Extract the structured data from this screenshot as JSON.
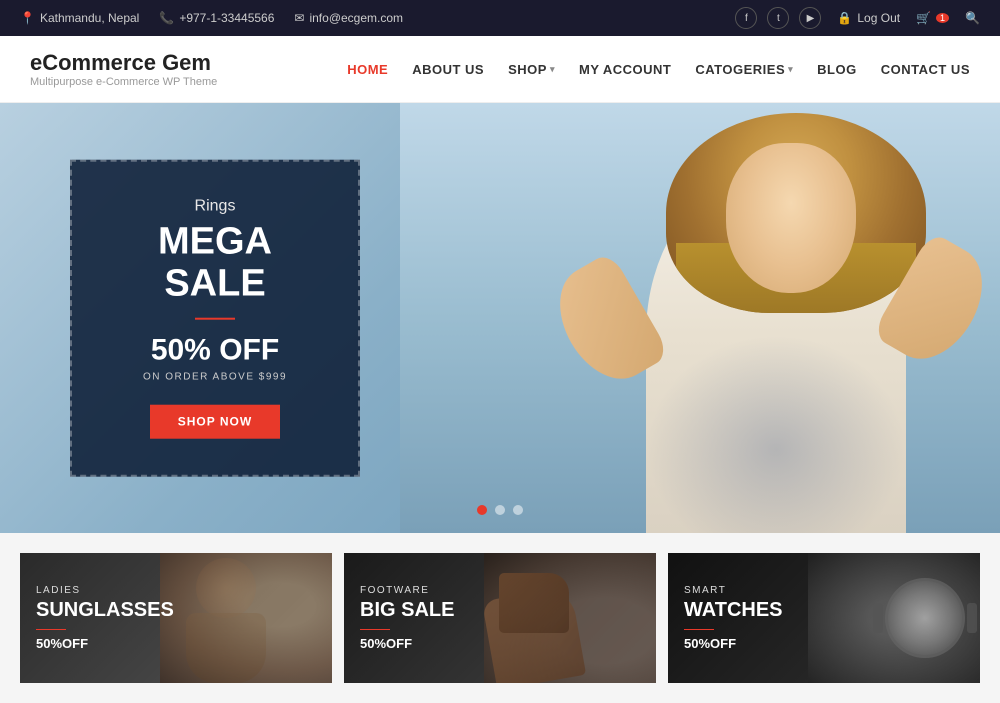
{
  "topbar": {
    "location": "Kathmandu, Nepal",
    "phone": "+977-1-33445566",
    "email": "info@ecgem.com",
    "logout_label": "Log Out",
    "social": [
      "f",
      "t",
      "y"
    ]
  },
  "header": {
    "logo_title": "eCommerce Gem",
    "logo_subtitle": "Multipurpose e-Commerce WP Theme"
  },
  "nav": {
    "items": [
      {
        "label": "HOME",
        "active": true,
        "has_dropdown": false
      },
      {
        "label": "ABOUT US",
        "active": false,
        "has_dropdown": false
      },
      {
        "label": "SHOP",
        "active": false,
        "has_dropdown": true
      },
      {
        "label": "MY ACCOUNT",
        "active": false,
        "has_dropdown": false
      },
      {
        "label": "CATOGERIES",
        "active": false,
        "has_dropdown": true
      },
      {
        "label": "BLOG",
        "active": false,
        "has_dropdown": false
      },
      {
        "label": "CONTACT US",
        "active": false,
        "has_dropdown": false
      }
    ]
  },
  "hero": {
    "promo_subtitle": "Rings",
    "promo_title": "MEGA SALE",
    "discount": "50% OFF",
    "condition": "ON ORDER ABOVE $999",
    "cta_label": "SHOP NOW",
    "dots": [
      true,
      false,
      false
    ]
  },
  "categories": [
    {
      "label": "LADIES",
      "title": "SUNGLASSES",
      "discount": "50%OFF"
    },
    {
      "label": "FOOTWARE",
      "title": "BIG SALE",
      "discount": "50%OFF"
    },
    {
      "label": "SMART",
      "title": "WATCHES",
      "discount": "50%OFF"
    }
  ]
}
